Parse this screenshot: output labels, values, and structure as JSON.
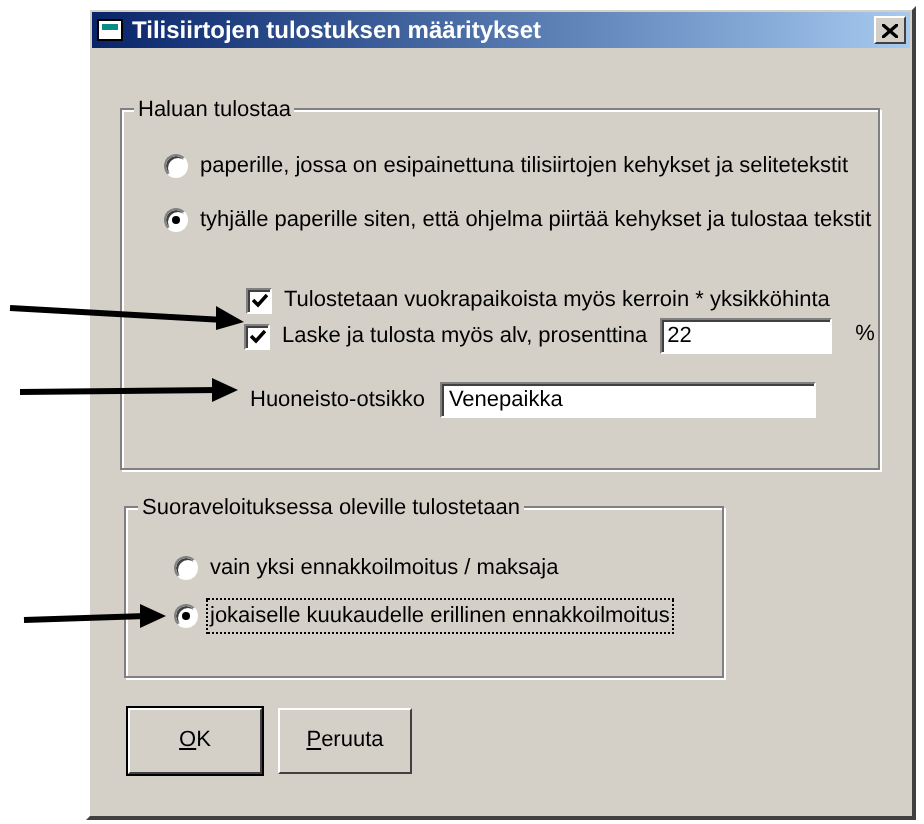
{
  "window": {
    "title": "Tilisiirtojen tulostuksen määritykset"
  },
  "print_group": {
    "title": "Haluan tulostaa",
    "options": [
      {
        "label": "paperille, jossa on esipainettuna tilisiirtojen kehykset ja selitetekstit",
        "selected": false
      },
      {
        "label": "tyhjälle paperille siten, että ohjelma piirtää kehykset ja tulostaa tekstit",
        "selected": true
      }
    ],
    "checkboxes": [
      {
        "kind": "plain",
        "label": "Tulostetaan vuokrapaikoista myös kerroin * yksikköhinta",
        "checked": true
      },
      {
        "kind": "with_field",
        "label": "Laske ja tulosta myös alv, prosenttina",
        "checked": true,
        "value": "22",
        "unit": "%"
      }
    ],
    "apartment_field": {
      "label": "Huoneisto-otsikko",
      "value": "Venepaikka"
    }
  },
  "direct_debit_group": {
    "title": "Suoraveloituksessa oleville tulostetaan",
    "options": [
      {
        "label": "vain yksi ennakkoilmoitus / maksaja",
        "selected": false,
        "focused": false
      },
      {
        "label": "jokaiselle kuukaudelle erillinen ennakkoilmoitus",
        "selected": true,
        "focused": true
      }
    ]
  },
  "buttons": [
    {
      "label": "OK",
      "default": true
    },
    {
      "label": "Peruuta",
      "default": false
    }
  ]
}
